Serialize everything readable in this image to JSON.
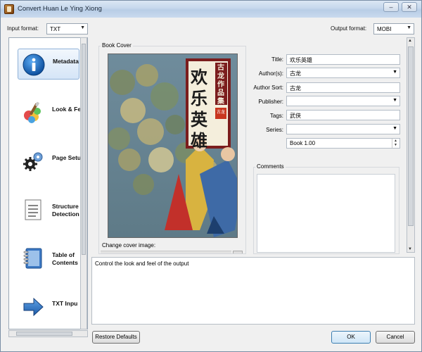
{
  "window": {
    "title": "Convert Huan Le Ying Xiong"
  },
  "title_buttons": {
    "minimize": "–",
    "close": "✕"
  },
  "input_format": {
    "label": "Input format:",
    "value": "TXT"
  },
  "output_format": {
    "label": "Output format:",
    "value": "MOBI"
  },
  "sidebar": {
    "items": [
      {
        "label": "Metadata",
        "icon": "info-icon"
      },
      {
        "label": "Look & Fe",
        "icon": "paint-brush-icon"
      },
      {
        "label": "Page Setup",
        "icon": "gear-icon"
      },
      {
        "label": "Structure\nDetection",
        "icon": "document-icon"
      },
      {
        "label": "Table of\nContents",
        "icon": "notebook-icon"
      },
      {
        "label": "TXT Inpu",
        "icon": "arrow-right-icon"
      }
    ]
  },
  "book_cover": {
    "group_title": "Book Cover",
    "change_label": "Change cover image:",
    "cover_title": "欢乐英雄",
    "cover_series": "古龙作品集",
    "cover_seal": "古龙"
  },
  "metadata": {
    "title_label": "Title:",
    "title_value": "欢乐英雄",
    "authors_label": "Author(s):",
    "authors_value": "古龙",
    "author_sort_label": "Author Sort:",
    "author_sort_value": "古龙",
    "publisher_label": "Publisher:",
    "publisher_value": "",
    "tags_label": "Tags:",
    "tags_value": "武侠",
    "series_label": "Series:",
    "series_value": "",
    "book_number": "Book 1.00"
  },
  "comments": {
    "group_title": "Comments"
  },
  "help_text": "Control the look and feel of the output",
  "buttons": {
    "restore_defaults": "Restore Defaults",
    "ok": "OK",
    "cancel": "Cancel"
  }
}
